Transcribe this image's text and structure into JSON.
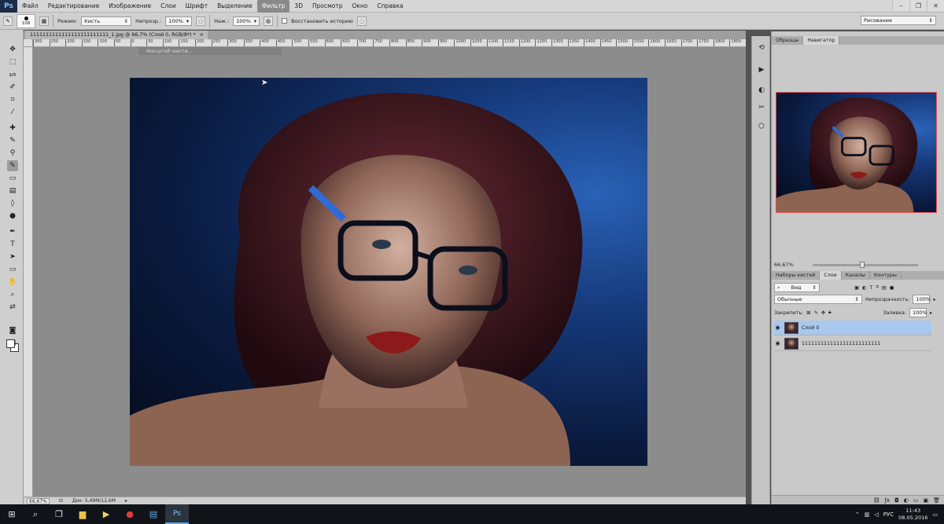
{
  "menubar": {
    "logo": "Ps",
    "items": [
      "Файл",
      "Редактирование",
      "Изображение",
      "Слои",
      "Шрифт",
      "Выделение",
      "Фильтр",
      "3D",
      "Просмотр",
      "Окно",
      "Справка"
    ],
    "active_item": "Фильтр"
  },
  "optionsbar": {
    "brush_size": "108",
    "mode_label": "Режим:",
    "mode_value": "Кисть",
    "opacity_label": "Непрозр.:",
    "opacity_value": "100%",
    "pressure_label": "Наж.:",
    "pressure_value": "100%",
    "restore_history_label": "Восстановить историю",
    "workspace_value": "Рисование"
  },
  "document": {
    "tab_title": "1111111111111111111111111_1.jpg @ 66,7% (Слой 0, RGB/8*) *",
    "tab_close": "×",
    "tooltip": "Масштаб кисти..."
  },
  "ruler": {
    "ticks": [
      "300",
      "250",
      "200",
      "150",
      "100",
      "50",
      "0",
      "50",
      "100",
      "150",
      "200",
      "250",
      "300",
      "350",
      "400",
      "450",
      "500",
      "550",
      "600",
      "650",
      "700",
      "750",
      "800",
      "850",
      "900",
      "950",
      "1000",
      "1050",
      "1100",
      "1150",
      "1200",
      "1250",
      "1300",
      "1350",
      "1400",
      "1450",
      "1500",
      "1550",
      "1600",
      "1650",
      "1700",
      "1750",
      "1800",
      "1850"
    ]
  },
  "statusbar": {
    "zoom": "66,67%",
    "doc_info": "Док: 5,49М/12,6М"
  },
  "panels": {
    "top_tabs": [
      "Образцы",
      "Навигатор"
    ],
    "navigator_zoom": "66,67%",
    "layers_tabs": [
      "Наборы кистей",
      "Слои",
      "Каналы",
      "Контуры"
    ],
    "filter_kind": "Вид",
    "blend_mode": "Обычные",
    "opacity_label": "Непрозрачность:",
    "opacity_value": "100%",
    "lock_label": "Закрепить:",
    "fill_label": "Заливка:",
    "fill_value": "100%",
    "layers": [
      {
        "name": "Слой 0",
        "selected": true
      },
      {
        "name": "1111111111111111111111111",
        "selected": false
      }
    ]
  },
  "taskbar": {
    "language": "РУС",
    "time": "11:43",
    "date": "08.05.2016"
  },
  "colors": {
    "menubar_bg": "#d6d6d6",
    "canvas_bg": "#8c8c8c",
    "selection_accent": "#a8c8ee",
    "navigator_frame": "#e05050"
  }
}
